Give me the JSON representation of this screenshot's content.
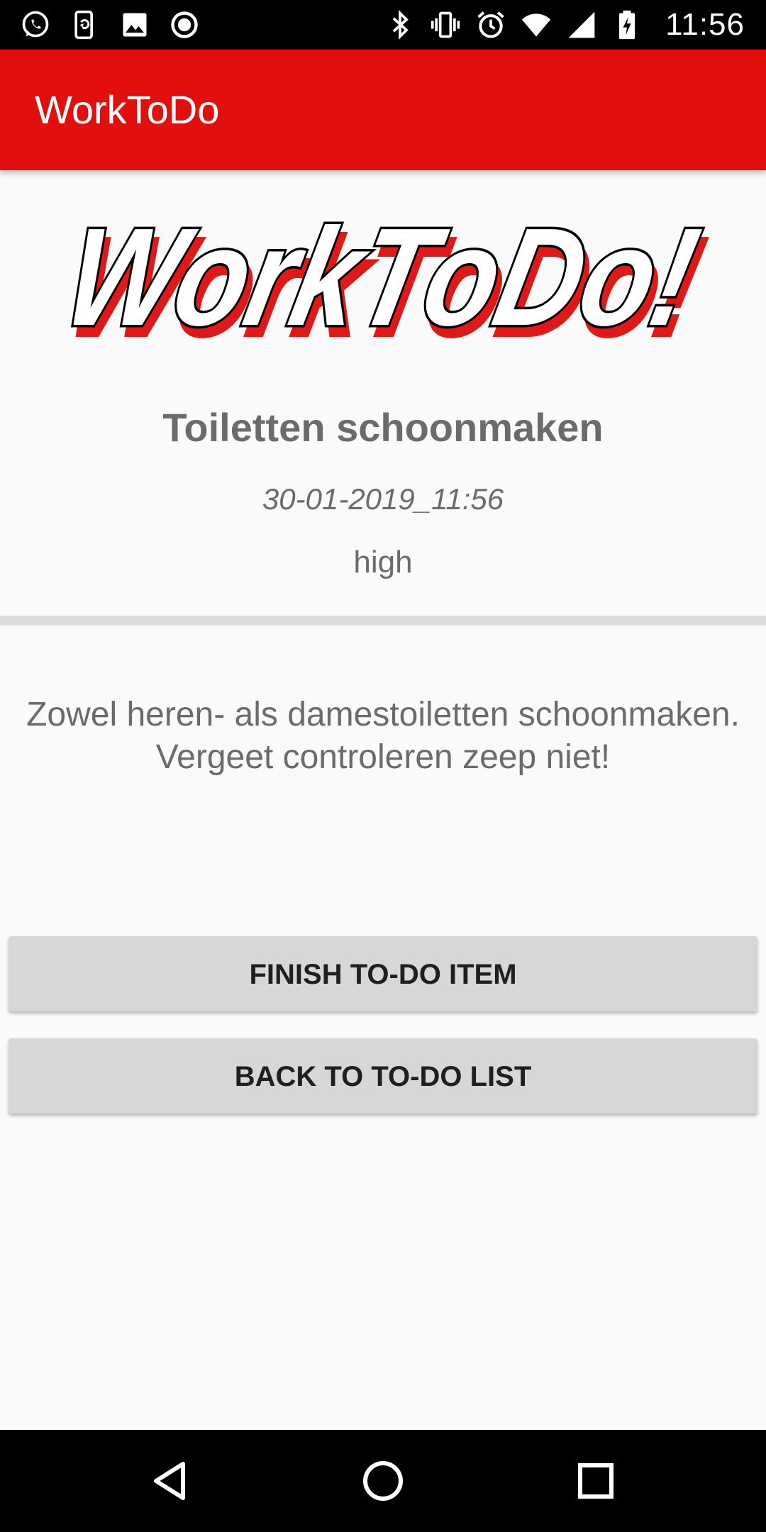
{
  "status_bar": {
    "time": "11:56",
    "left_icons": [
      "whatsapp-icon",
      "phone-sync-icon",
      "image-icon",
      "record-icon"
    ],
    "right_icons": [
      "bluetooth-icon",
      "vibrate-icon",
      "alarm-icon",
      "wifi-icon",
      "signal-icon",
      "battery-charging-icon"
    ]
  },
  "app_bar": {
    "title": "WorkToDo",
    "color": "#e30e0e"
  },
  "logo": {
    "text": "WorkToDo!"
  },
  "task": {
    "title": "Toiletten schoonmaken",
    "date": "30-01-2019_11:56",
    "priority": "high",
    "description_line1": "Zowel heren- als damestoiletten schoonmaken.",
    "description_line2": "Vergeet controleren zeep niet!"
  },
  "buttons": {
    "finish_label": "FINISH TO-DO ITEM",
    "back_label": "BACK TO TO-DO LIST"
  },
  "nav_bar": {
    "icons": [
      "back-triangle-icon",
      "home-circle-icon",
      "recents-square-icon"
    ]
  }
}
